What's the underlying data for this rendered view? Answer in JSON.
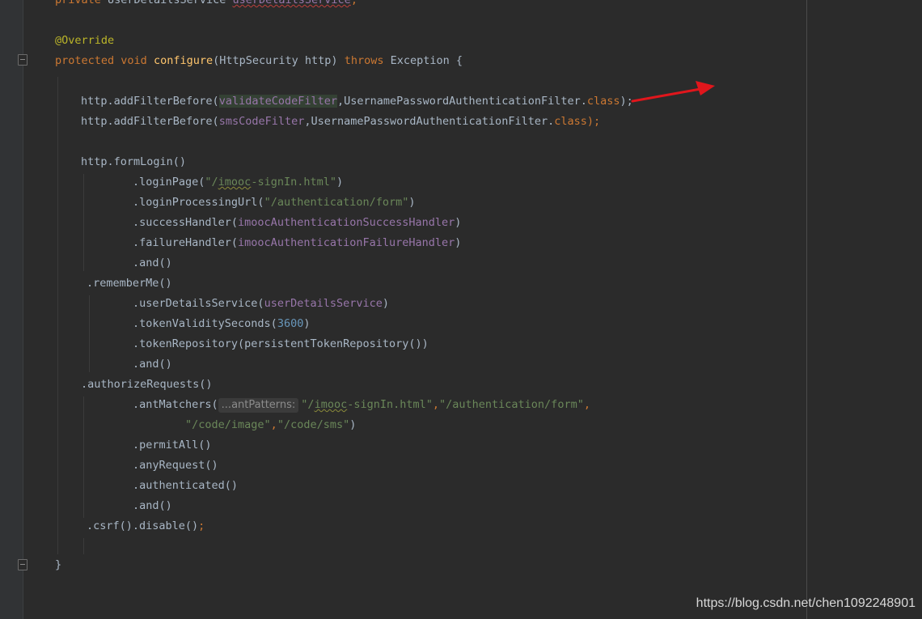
{
  "code": {
    "line0": {
      "kw": "private",
      "type": "UserDetailsService",
      "field": "userDetailsService",
      "semi": ";"
    },
    "line_override": "@Override",
    "line_sig": {
      "kw1": "protected",
      "kw2": "void",
      "fn": "configure",
      "args": "(HttpSecurity http)",
      "kw3": "throws",
      "rest": "Exception {"
    },
    "line_filter1": {
      "pre": "http.addFilterBefore(",
      "arg": "validateCodeFilter",
      "mid": ",UsernamePasswordAuthenticationFilter.",
      "kw": "class",
      "end": ");"
    },
    "line_filter2": {
      "pre": "http.addFilterBefore(",
      "arg": "smsCodeFilter",
      "mid": ",UsernamePasswordAuthenticationFilter.",
      "kw": "class",
      "end": ");"
    },
    "line_formlogin": "http.formLogin()",
    "line_loginpage": {
      "pre": ".loginPage(",
      "q1": "\"/",
      "sq": "imooc",
      "rest": "-signIn.html\"",
      "end": ")"
    },
    "line_loginproc": {
      "pre": ".loginProcessingUrl(",
      "str": "\"/authentication/form\"",
      "end": ")"
    },
    "line_success": {
      "pre": ".successHandler(",
      "fld": "imoocAuthenticationSuccessHandler",
      "end": ")"
    },
    "line_failure": {
      "pre": ".failureHandler(",
      "fld": "imoocAuthenticationFailureHandler",
      "end": ")"
    },
    "line_and1": ".and()",
    "line_rememberme": ".rememberMe()",
    "line_uds": {
      "pre": ".userDetailsService(",
      "fld": "userDetailsService",
      "end": ")"
    },
    "line_tvs": {
      "pre": ".tokenValiditySeconds(",
      "num": "3600",
      "end": ")"
    },
    "line_repo": ".tokenRepository(persistentTokenRepository())",
    "line_and2": ".and()",
    "line_authreq": ".authorizeRequests()",
    "line_antmatchers": {
      "pre": ".antMatchers(",
      "hint": "...antPatterns:",
      "q1": "\"/",
      "sq": "imooc",
      "s1": "-signIn.html\"",
      "c1": ",",
      "s2": "\"/authentication/form\"",
      "c2": ","
    },
    "line_antmatchers2": {
      "s3": "\"/code/image\"",
      "c3": ",",
      "s4": "\"/code/sms\"",
      "end": ")"
    },
    "line_permitall": ".permitAll()",
    "line_anyrequest": ".anyRequest()",
    "line_authenticated": ".authenticated()",
    "line_and3": ".and()",
    "line_csrf": {
      "pre": ".csrf().disable()",
      "semi": ";"
    },
    "line_close": "}"
  },
  "watermark": "https://blog.csdn.net/chen1092248901",
  "colors": {
    "background": "#2b2b2b",
    "keyword": "#cc7832",
    "annotation": "#bbb529",
    "method": "#ffc66d",
    "field": "#9876aa",
    "string": "#6a8759",
    "number": "#6897bb",
    "text": "#a9b7c6",
    "arrow": "#e0161c"
  }
}
